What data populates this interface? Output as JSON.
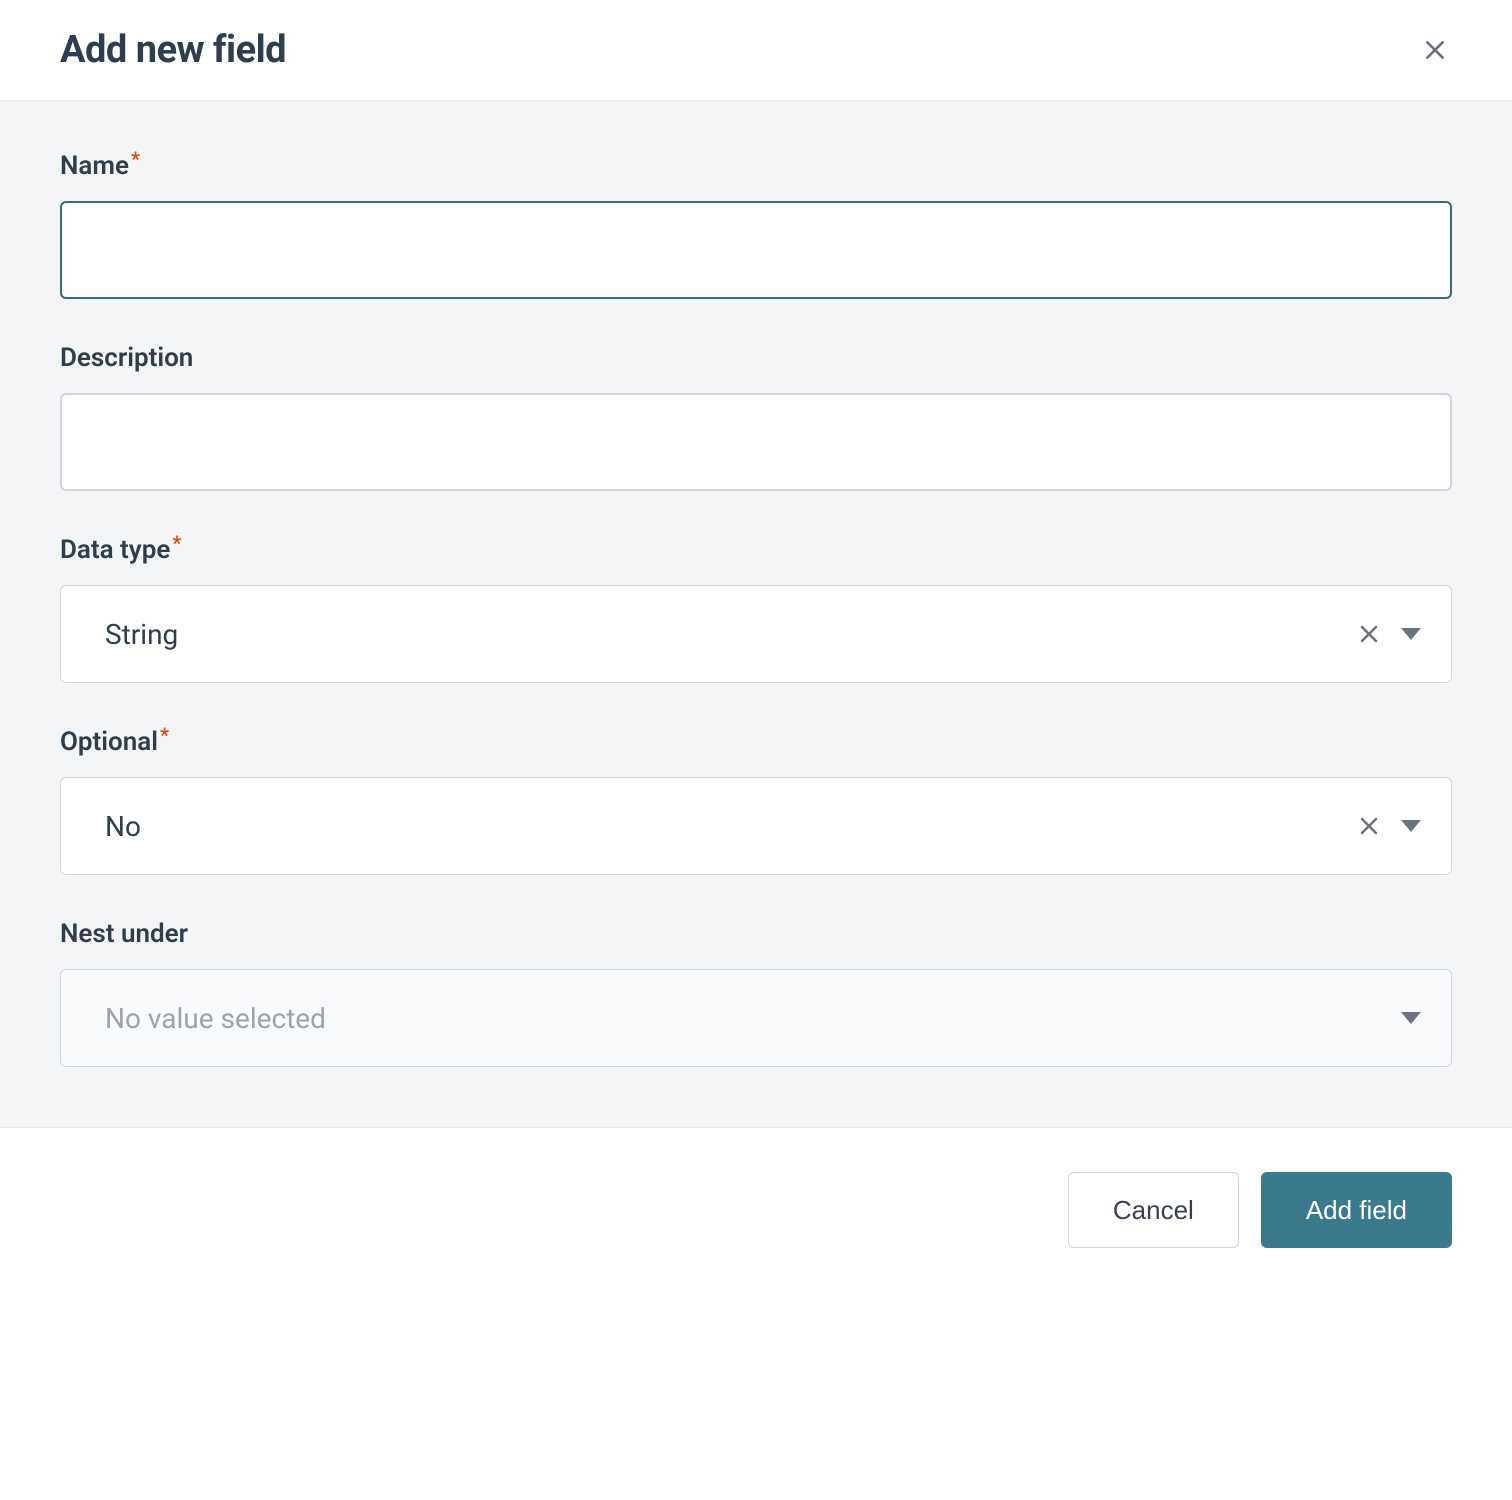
{
  "dialog": {
    "title": "Add new field"
  },
  "form": {
    "name": {
      "label": "Name",
      "required": true,
      "value": ""
    },
    "description": {
      "label": "Description",
      "required": false,
      "value": ""
    },
    "dataType": {
      "label": "Data type",
      "required": true,
      "selected": "String"
    },
    "optional": {
      "label": "Optional",
      "required": true,
      "selected": "No"
    },
    "nestUnder": {
      "label": "Nest under",
      "required": false,
      "placeholder": "No value selected",
      "selected": null
    }
  },
  "footer": {
    "cancel": "Cancel",
    "submit": "Add field"
  },
  "required_star": "*"
}
